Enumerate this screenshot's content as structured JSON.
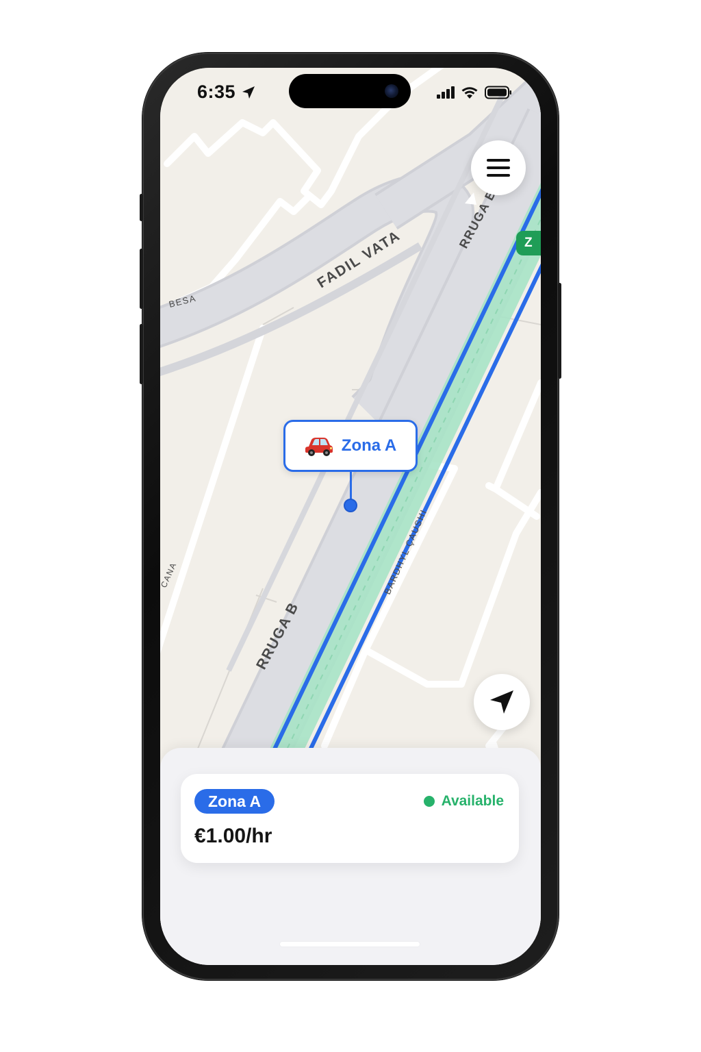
{
  "status_bar": {
    "time": "6:35",
    "location_icon": "location-arrow-icon",
    "signal_icon": "cellular-signal-icon",
    "wifi_icon": "wifi-icon",
    "battery_icon": "battery-icon"
  },
  "map": {
    "street_labels": [
      "FADIL VATA",
      "BESA",
      "RRUGA B",
      "RRUGA B",
      "BARDHYL ÇAUSHI",
      "CANA"
    ],
    "zone_marker": {
      "icon": "car-icon",
      "label": "Zona A",
      "color": "#2a6ce8"
    },
    "edge_zone_badge": "Z",
    "route_color": "#2a6ce8",
    "zone_fill_color": "#a7e3c6"
  },
  "controls": {
    "menu_icon": "hamburger-menu-icon",
    "locate_icon": "navigation-arrow-icon"
  },
  "zone_card": {
    "zone_name": "Zona A",
    "status": "Available",
    "status_color": "#27b26b",
    "price": "€1.00/hr"
  }
}
